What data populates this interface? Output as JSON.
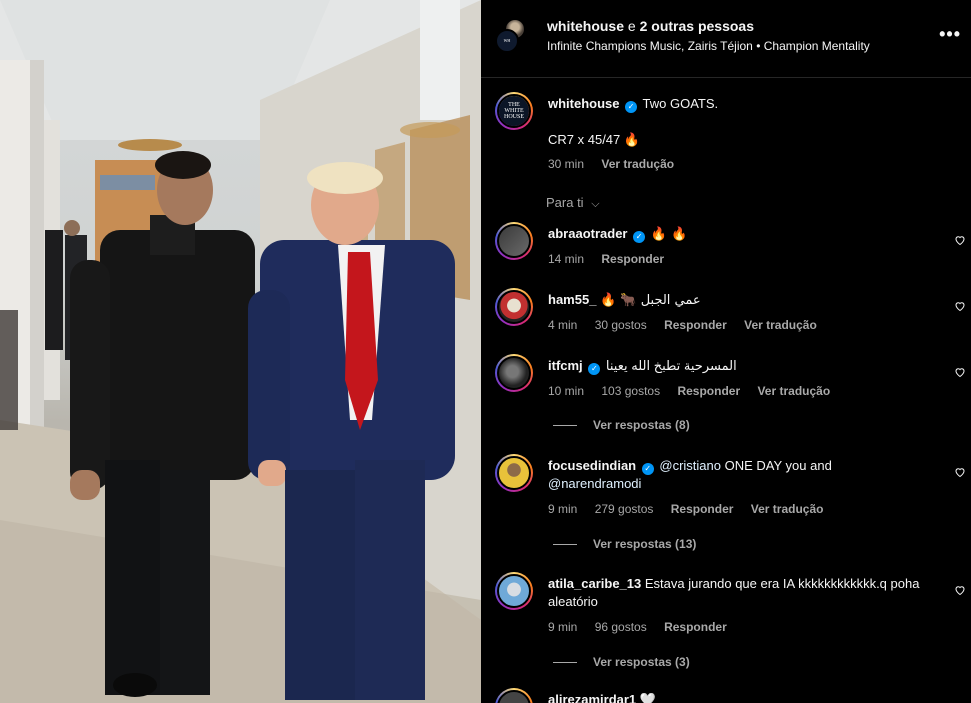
{
  "header": {
    "author": "whitehouse",
    "joiner": "e",
    "others": "2 outras pessoas",
    "subtitle": "Infinite Champions Music, Zairis Téjion • Champion Mentality",
    "more": "•••"
  },
  "post": {
    "username": "whitehouse",
    "caption_line1": "Two GOATS.",
    "caption_line2": "CR7 x 45/47 🔥",
    "time": "30 min",
    "translate": "Ver tradução",
    "avatar_text": "THE WHITE HOUSE"
  },
  "sort": {
    "label": "Para ti"
  },
  "comments": [
    {
      "username": "abraaotrader",
      "verified": true,
      "text": "🔥 🔥",
      "time": "14 min",
      "likes": "",
      "reply": "Responder",
      "translate": ""
    },
    {
      "username": "ham55_",
      "verified": false,
      "text": "🔥 🐂 عمي الجبل",
      "time": "4 min",
      "likes": "30 gostos",
      "reply": "Responder",
      "translate": "Ver tradução"
    },
    {
      "username": "itfcmj",
      "verified": true,
      "text": "المسرحية تطبخ الله يعينا",
      "time": "10 min",
      "likes": "103 gostos",
      "reply": "Responder",
      "translate": "Ver tradução",
      "replies": "Ver respostas (8)"
    },
    {
      "username": "focusedindian",
      "verified": true,
      "mention1": "@cristiano",
      "text": "ONE DAY you and",
      "mention2": "@narendramodi",
      "time": "9 min",
      "likes": "279 gostos",
      "reply": "Responder",
      "translate": "Ver tradução",
      "replies": "Ver respostas (13)"
    },
    {
      "username": "atila_caribe_13",
      "verified": false,
      "text": "Estava jurando que era IA kkkkkkkkkkkk.q poha aleatório",
      "time": "9 min",
      "likes": "96 gostos",
      "reply": "Responder",
      "replies": "Ver respostas (3)"
    },
    {
      "username": "alirezamirdar1",
      "verified": false,
      "text": "🤍"
    }
  ],
  "colors": {
    "verified": "#0095f6",
    "secondary_text": "#a8a8a8",
    "background": "#000000"
  }
}
